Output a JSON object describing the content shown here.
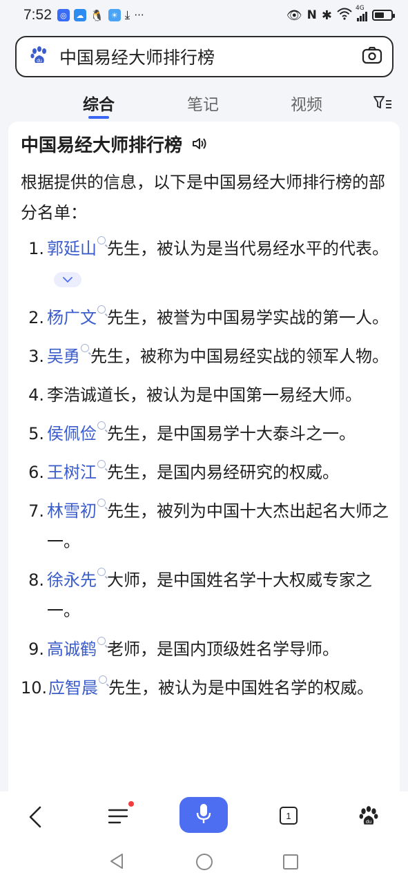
{
  "status_bar": {
    "time": "7:52",
    "more": "···",
    "signal_label": "4G",
    "battery_level": 0.6
  },
  "search": {
    "query": "中国易经大师排行榜",
    "icons": [
      "baidu-paw-icon",
      "camera-icon"
    ]
  },
  "tabs": [
    {
      "label": "综合",
      "active": true
    },
    {
      "label": "笔记",
      "active": false
    },
    {
      "label": "视频",
      "active": false
    }
  ],
  "answer": {
    "title": "中国易经大师排行榜",
    "intro": "根据提供的信息，以下是中国易经大师排行榜的部分名单：",
    "items": [
      {
        "num": "1.",
        "name": "郭延山",
        "linked": true,
        "text": "先生，被认为是当代易经水平的代表。"
      },
      {
        "num": "2.",
        "name": "杨广文",
        "linked": true,
        "text": "先生，被誉为中国易学实战的第一人。"
      },
      {
        "num": "3.",
        "name": "吴勇",
        "linked": true,
        "text": "先生，被称为中国易经实战的领军人物。"
      },
      {
        "num": "4.",
        "name": "李浩诚道长",
        "linked": false,
        "text": "，被认为是中国第一易经大师。"
      },
      {
        "num": "5.",
        "name": "侯佩俭",
        "linked": true,
        "text": "先生，是中国易学十大泰斗之一。"
      },
      {
        "num": "6.",
        "name": "王树江",
        "linked": true,
        "text": "先生，是国内易经研究的权威。"
      },
      {
        "num": "7.",
        "name": "林雪初",
        "linked": true,
        "text": "先生，被列为中国十大杰出起名大师之一。"
      },
      {
        "num": "8.",
        "name": "徐永先",
        "linked": true,
        "text": "大师，是中国姓名学十大权威专家之一。"
      },
      {
        "num": "9.",
        "name": "高诚鹤",
        "linked": true,
        "text": "老师，是国内顶级姓名学导师。"
      },
      {
        "num": "10.",
        "name": "应智晨",
        "linked": true,
        "text": "先生，被认为是中国姓名学的权威。"
      }
    ]
  },
  "bottom_nav": {
    "tab_count": "1"
  },
  "colors": {
    "accent": "#4e6ef2",
    "link": "#3b5ccc",
    "notification_dot": "#f03d3d"
  }
}
